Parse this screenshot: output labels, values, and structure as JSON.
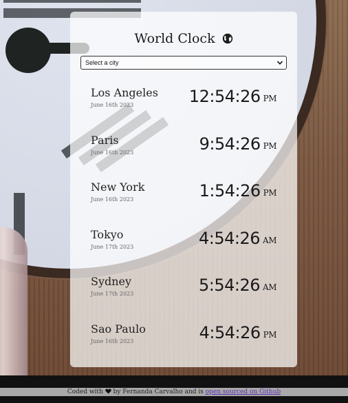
{
  "app": {
    "title": "World Clock",
    "title_icon": "globe-icon"
  },
  "city_select": {
    "selected": "Select a city"
  },
  "cities": [
    {
      "name": "Los Angeles",
      "date": "June 16th 2023",
      "time": "12:54:26",
      "ampm": "PM"
    },
    {
      "name": "Paris",
      "date": "June 16th 2023",
      "time": "9:54:26",
      "ampm": "PM"
    },
    {
      "name": "New York",
      "date": "June 16th 2023",
      "time": "1:54:26",
      "ampm": "PM"
    },
    {
      "name": "Tokyo",
      "date": "June 17th 2023",
      "time": "4:54:26",
      "ampm": "AM"
    },
    {
      "name": "Sydney",
      "date": "June 17th 2023",
      "time": "5:54:26",
      "ampm": "AM"
    },
    {
      "name": "Sao Paulo",
      "date": "June 16th 2023",
      "time": "4:54:26",
      "ampm": "PM"
    }
  ],
  "footer": {
    "prefix": "Coded with",
    "heart_icon": "heart-icon",
    "middle": "by Fernanda Carvalho and is",
    "link_text": "open sourced on Github"
  },
  "colors": {
    "card_bg": "#ffffffb8",
    "link": "#5a2fb0"
  }
}
